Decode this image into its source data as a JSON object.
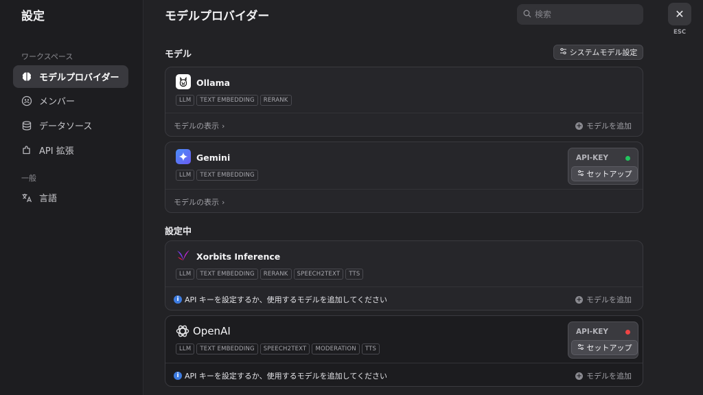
{
  "sidebar": {
    "title": "設定",
    "workspace_label": "ワークスペース",
    "general_label": "一般",
    "items": [
      {
        "label": "モデルプロバイダー",
        "icon": "brain-icon"
      },
      {
        "label": "メンバー",
        "icon": "members-icon"
      },
      {
        "label": "データソース",
        "icon": "database-icon"
      },
      {
        "label": "API 拡張",
        "icon": "puzzle-icon"
      },
      {
        "label": "言語",
        "icon": "translate-icon"
      }
    ]
  },
  "header": {
    "title": "モデルプロバイダー",
    "search_placeholder": "検索",
    "close_label": "ESC"
  },
  "models_section": {
    "title": "モデル",
    "system_settings_label": "システムモデル設定"
  },
  "configuring_section": {
    "title": "設定中"
  },
  "providers": [
    {
      "name": "Ollama",
      "tags": [
        "LLM",
        "TEXT EMBEDDING",
        "RERANK"
      ],
      "footer_left": "モデルの表示",
      "footer_right": "モデルを追加"
    },
    {
      "name": "Gemini",
      "tags": [
        "LLM",
        "TEXT EMBEDDING"
      ],
      "footer_left": "モデルの表示",
      "api_key_label": "API-KEY",
      "api_status_color": "#22c55e",
      "setup_label": "セットアップ"
    },
    {
      "name": "Xorbits Inference",
      "tags": [
        "LLM",
        "TEXT EMBEDDING",
        "RERANK",
        "SPEECH2TEXT",
        "TTS"
      ],
      "footer_left": "API キーを設定するか、使用するモデルを追加してください",
      "footer_right": "モデルを追加"
    },
    {
      "name": "OpenAI",
      "tags": [
        "LLM",
        "TEXT EMBEDDING",
        "SPEECH2TEXT",
        "MODERATION",
        "TTS"
      ],
      "footer_left": "API キーを設定するか、使用するモデルを追加してください",
      "footer_right": "モデルを追加",
      "api_key_label": "API-KEY",
      "api_status_color": "#ef4444",
      "setup_label": "セットアップ"
    }
  ]
}
